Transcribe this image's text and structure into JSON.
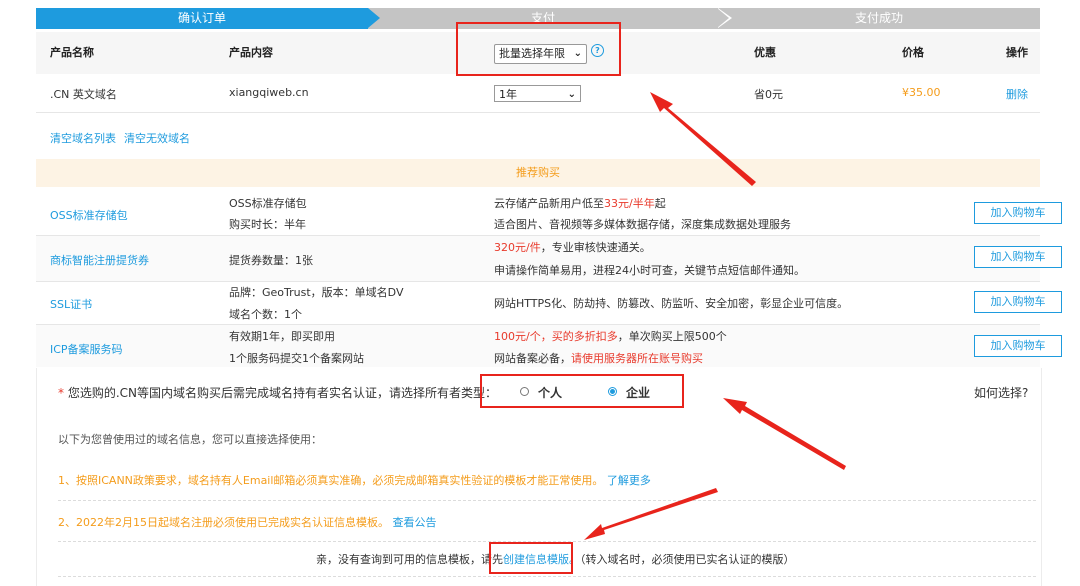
{
  "steps": [
    "确认订单",
    "支付",
    "支付成功"
  ],
  "table": {
    "headers": [
      "产品名称",
      "产品内容",
      "优惠",
      "价格",
      "操作"
    ],
    "batch_select": "批量选择年限",
    "help_icon": "?",
    "row": {
      "name": ".CN 英文域名",
      "content": "xiangqiweb.cn",
      "years": "1年",
      "discount": "省0元",
      "price": "¥35.00",
      "action": "删除"
    }
  },
  "links": {
    "clear_list": "清空域名列表",
    "clear_invalid": "清空无效域名"
  },
  "recommend": {
    "title": "推荐购买",
    "button": "加入购物车",
    "items": [
      {
        "name": "OSS标准存储包",
        "content1": "OSS标准存储包",
        "content2": "购买时长：半年",
        "desc1_pre": "云存储产品新用户低至",
        "desc1_red": "33元/半年",
        "desc1_post": "起",
        "desc2": "适合图片、音视频等多媒体数据存储，深度集成数据处理服务"
      },
      {
        "name": "商标智能注册提货券",
        "content1": "提货券数量：1张",
        "content2": "",
        "desc1_red": "320元/件",
        "desc1_post": "，专业审核快速通关。",
        "desc2": "申请操作简单易用，进程24小时可查，关键节点短信邮件通知。"
      },
      {
        "name": "SSL证书",
        "content1": "品牌：GeoTrust，版本：单域名DV",
        "content2": "域名个数：1个",
        "desc1": "网站HTTPS化、防劫持、防篡改、防监听、安全加密，彰显企业可信度。"
      },
      {
        "name": "ICP备案服务码",
        "content1": "有效期1年，即买即用",
        "content2": "1个服务码提交1个备案网站",
        "desc1_red": "100元/个，买的多折扣多",
        "desc1_post": "，单次购买上限500个",
        "desc2_pre": "网站备案必备，",
        "desc2_red": "请使用服务器所在账号购买"
      }
    ]
  },
  "owner": {
    "star": "*",
    "notice": "您选购的.CN等国内域名购买后需完成域名持有者实名认证，请选择所有者类型：",
    "option_personal": "个人",
    "option_company": "企业",
    "selected": "企业",
    "how_to": "如何选择?",
    "used_info": "以下为您曾使用过的域名信息，您可以直接选择使用：",
    "note1": "1、按照ICANN政策要求，域名持有人Email邮箱必须真实准确，必须完成邮箱真实性验证的模板才能正常使用。",
    "note1_link": "了解更多",
    "note2": "2、2022年2月15日起域名注册必须使用已完成实名认证信息模板。",
    "note2_link": "查看公告",
    "empty_pre": "亲，没有查询到可用的信息模板，请先",
    "empty_link": "创建信息模版。",
    "empty_post": "（转入域名时，必须使用已实名认证的模版）"
  },
  "colors": {
    "accent": "#1e9bde",
    "orange": "#f49c1b",
    "red": "#e83a2c",
    "annotation": "#e8241c"
  }
}
